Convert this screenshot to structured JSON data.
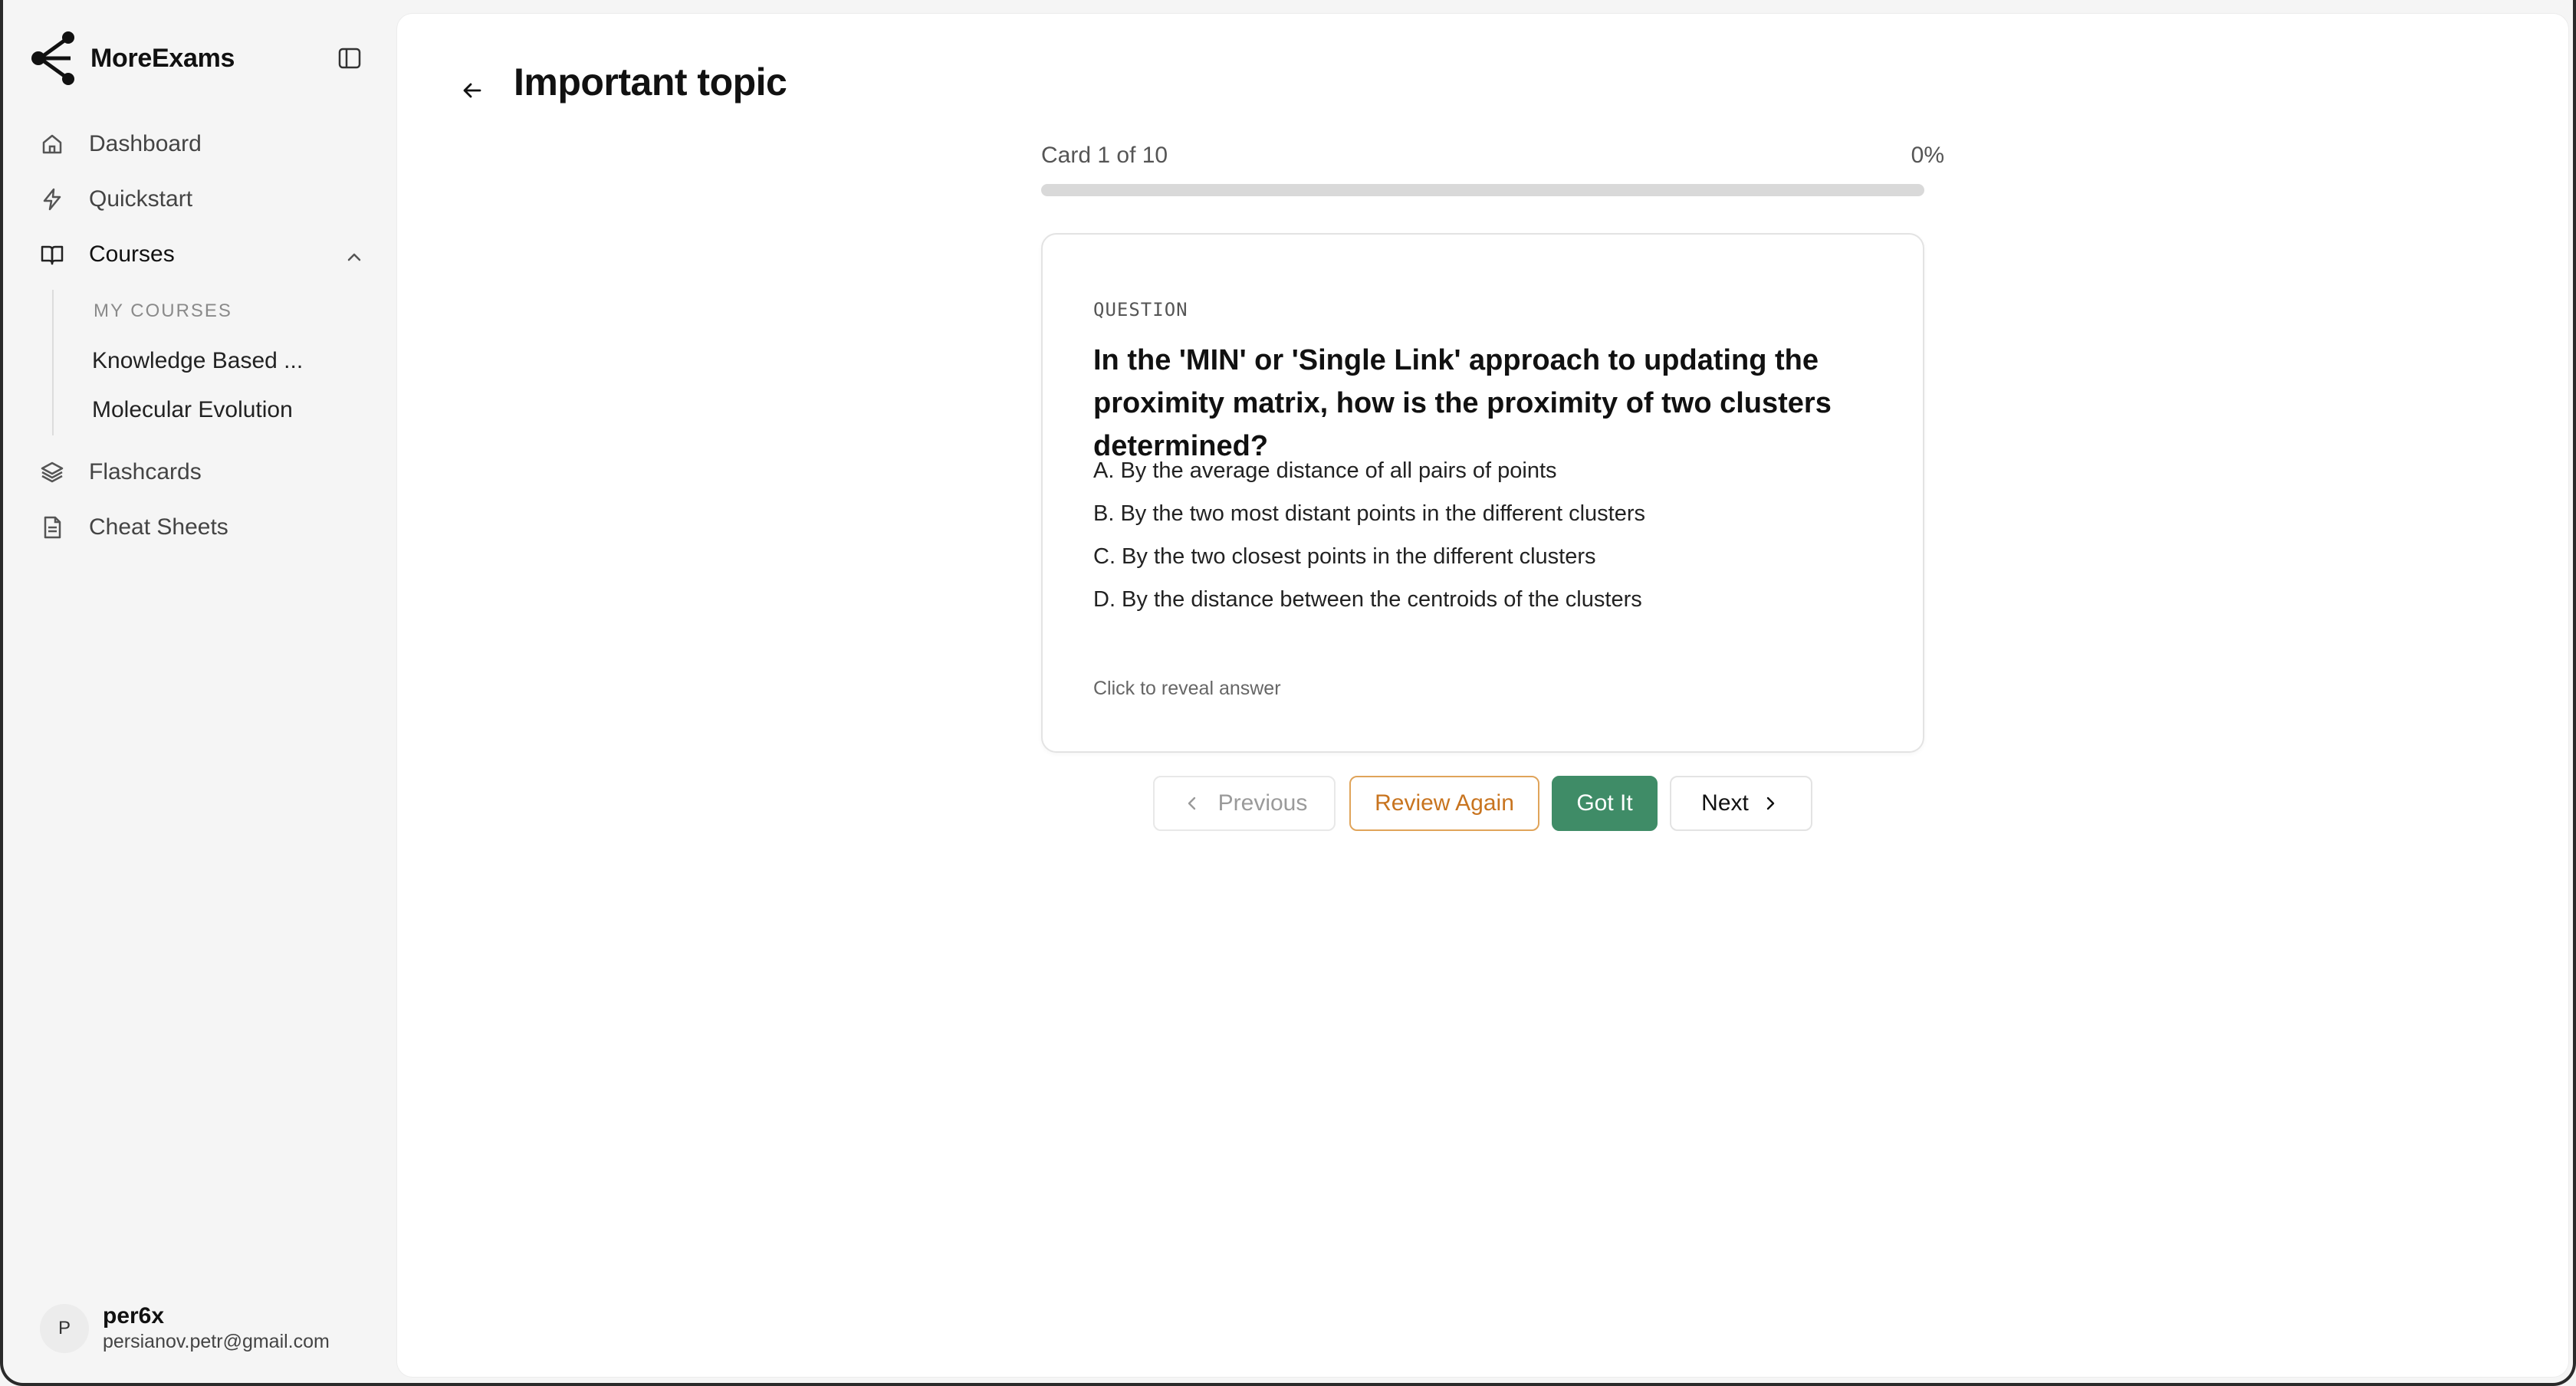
{
  "app": {
    "name": "MoreExams"
  },
  "sidebar": {
    "items": [
      {
        "label": "Dashboard",
        "icon": "home-icon"
      },
      {
        "label": "Quickstart",
        "icon": "lightning-icon"
      },
      {
        "label": "Courses",
        "icon": "book-open-icon",
        "expanded": true
      },
      {
        "label": "Flashcards",
        "icon": "layers-icon"
      },
      {
        "label": "Cheat Sheets",
        "icon": "document-icon"
      }
    ],
    "courses": {
      "heading": "MY COURSES",
      "items": [
        "Knowledge Based ...",
        "Molecular Evolution"
      ]
    }
  },
  "user": {
    "initial": "P",
    "name": "per6x",
    "email": "persianov.petr@gmail.com"
  },
  "page": {
    "title": "Important topic"
  },
  "progress": {
    "label": "Card 1 of 10",
    "percent_text": "0%",
    "fraction": 0
  },
  "card": {
    "label": "QUESTION",
    "question": "In the 'MIN' or 'Single Link' approach to updating the proximity matrix, how is the proximity of two clusters determined?",
    "options": [
      "A. By the average distance of all pairs of points",
      "B. By the two most distant points in the different clusters",
      "C. By the two closest points in the different clusters",
      "D. By the distance between the centroids of the clusters"
    ],
    "hint": "Click to reveal answer"
  },
  "actions": {
    "previous": "Previous",
    "review_again": "Review Again",
    "got_it": "Got It",
    "next": "Next"
  },
  "colors": {
    "accent_green": "#3f8c67",
    "review_orange": "#c8741f"
  }
}
